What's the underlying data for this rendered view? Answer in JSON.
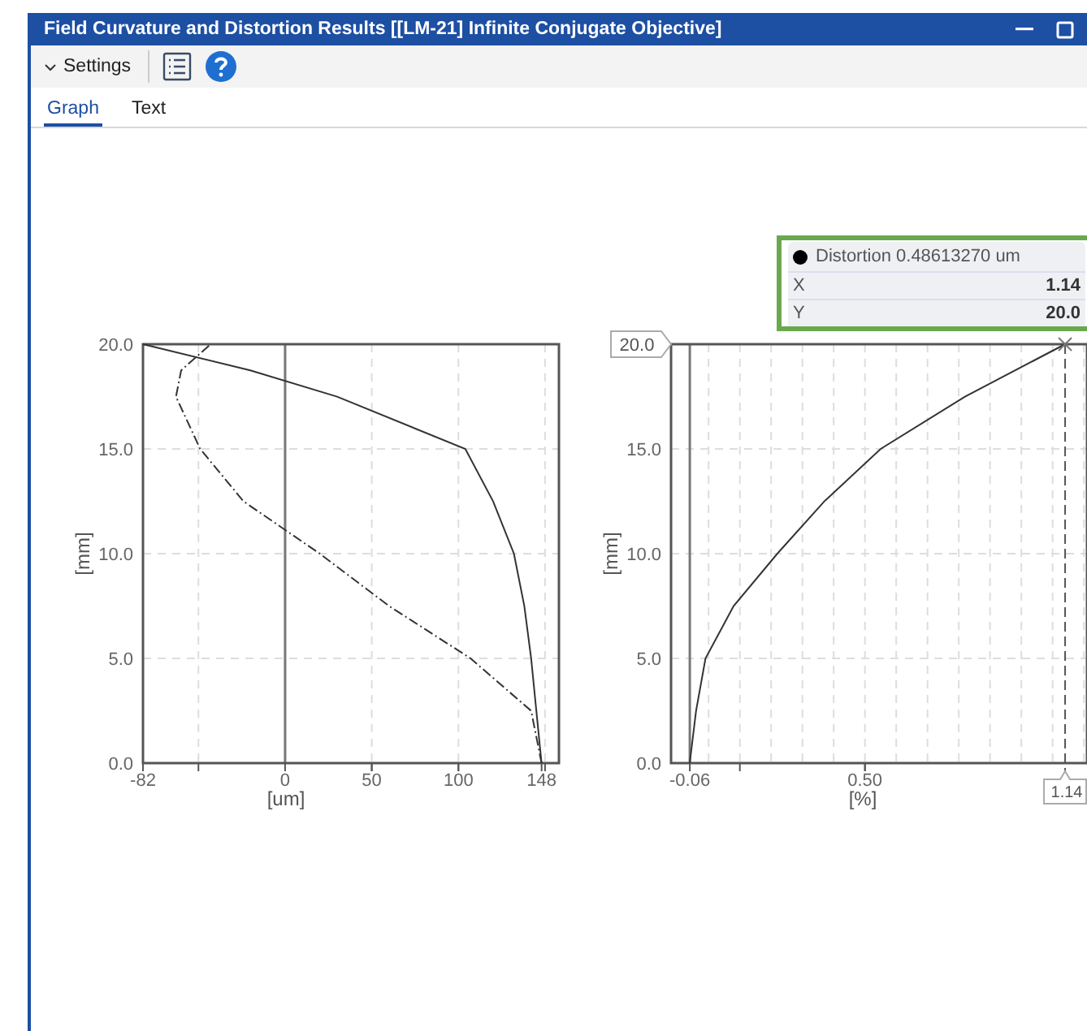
{
  "window": {
    "title": "Field Curvature and Distortion Results [[LM-21] Infinite Conjugate Objective]"
  },
  "toolbar": {
    "settings_label": "Settings"
  },
  "tabs": [
    {
      "label": "Graph",
      "selected": true
    },
    {
      "label": "Text",
      "selected": false
    }
  ],
  "charts": [
    {
      "chart_data": {
        "type": "line",
        "orientation": "horizontal",
        "grid": true,
        "ref_lines": [
          {
            "axis": "x",
            "value": 0
          }
        ],
        "xlabel": "[um]",
        "ylabel": "[mm]",
        "x": [
          0,
          2.5,
          5,
          7.5,
          10,
          12.5,
          15,
          17.5,
          18.75,
          20
        ],
        "xlim": [
          -82,
          158
        ],
        "xticks": [
          -82,
          0,
          50,
          100,
          148
        ],
        "ylim": [
          0,
          20
        ],
        "yticks": [
          {
            "value": 0,
            "label": "0.0"
          },
          {
            "value": 5,
            "label": "5.0"
          },
          {
            "value": 10,
            "label": "10.0"
          },
          {
            "value": 15,
            "label": "15.0"
          },
          {
            "value": 20,
            "label": "20.0"
          }
        ],
        "series": [
          {
            "color": "#333333",
            "line_style": "solid",
            "values": [
              148,
              145,
              142,
              138,
              132,
              120,
              104,
              30,
              -20,
              -82
            ]
          },
          {
            "color": "#333333",
            "line_style": "dashdot",
            "values": [
              148,
              142,
              107,
              60,
              20,
              -24,
              -49,
              -63,
              -60,
              -43
            ]
          }
        ]
      }
    },
    {
      "chart_data": {
        "type": "line",
        "orientation": "horizontal",
        "grid": true,
        "ref_lines": [
          {
            "axis": "x",
            "value": -0.06
          },
          {
            "axis": "x",
            "value": 1.14
          },
          {
            "axis": "y",
            "value": 20
          }
        ],
        "xlabel": "[%]",
        "ylabel": "[mm]",
        "x": [
          0,
          2.5,
          5,
          7.5,
          10,
          12.5,
          15,
          17.5,
          20
        ],
        "xlim": [
          -0.12,
          1.21
        ],
        "xticks": [
          {
            "value": -0.06,
            "label": "-0.06"
          },
          {
            "value": 0.5,
            "label": "0.50"
          }
        ],
        "ylim": [
          0,
          20
        ],
        "yticks": [
          {
            "value": 0,
            "label": "0.0"
          },
          {
            "value": 5,
            "label": "5.0"
          },
          {
            "value": 10,
            "label": "10.0"
          },
          {
            "value": 15,
            "label": "15.0"
          }
        ],
        "series": [
          {
            "color": "#333333",
            "line_style": "solid",
            "values": [
              -0.06,
              -0.04,
              -0.01,
              0.08,
              0.22,
              0.37,
              0.55,
              0.82,
              1.14
            ]
          }
        ]
      },
      "cursor": {
        "y_label": "20.0",
        "x_label": "1.14"
      },
      "tooltip": {
        "title": "Distortion 0.48613270 um",
        "rows": [
          {
            "label": "X",
            "value": "1.14"
          },
          {
            "label": "Y",
            "value": "20.0"
          }
        ]
      }
    }
  ]
}
